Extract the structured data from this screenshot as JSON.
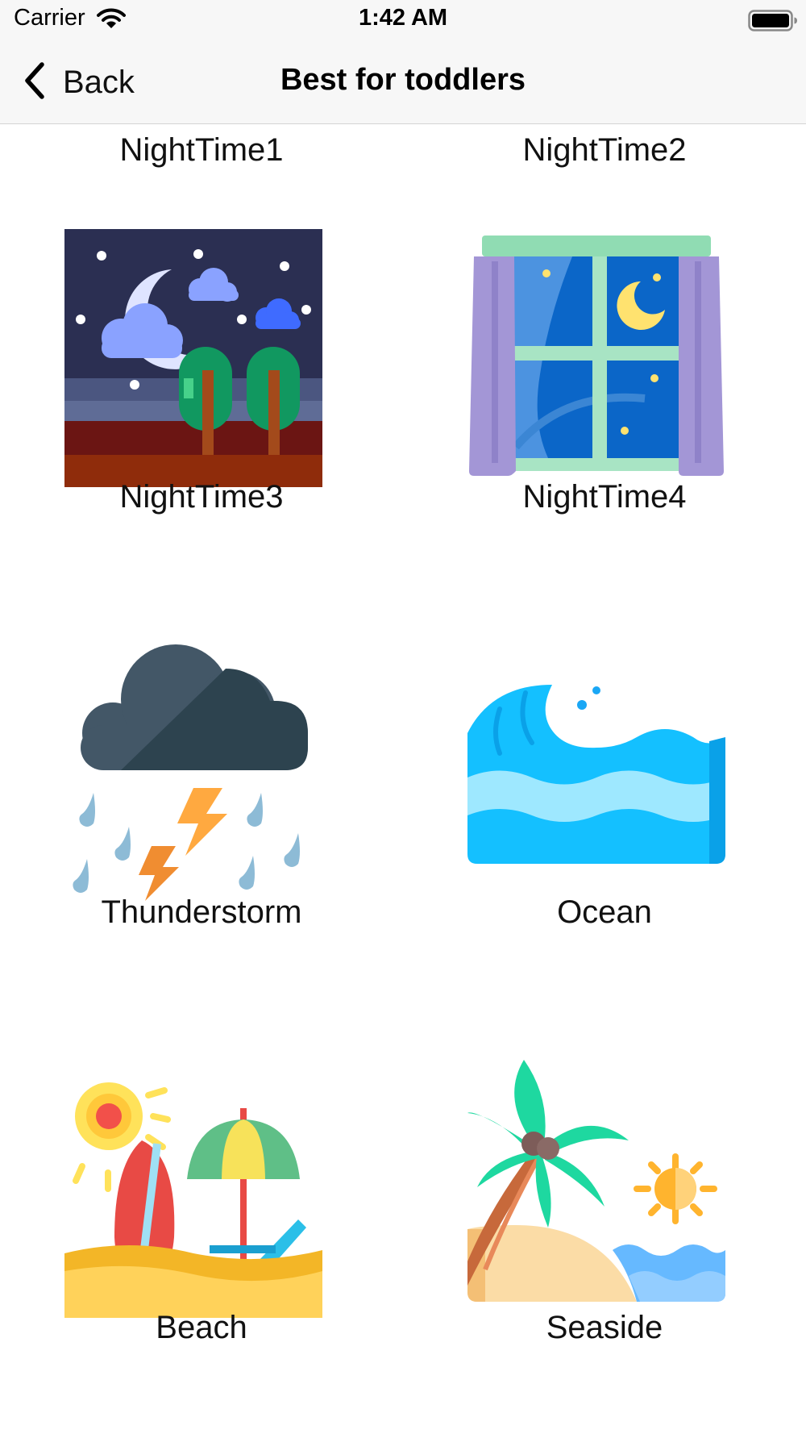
{
  "status": {
    "carrier": "Carrier",
    "time": "1:42 AM"
  },
  "nav": {
    "back_label": "Back",
    "title": "Best for toddlers"
  },
  "sounds": [
    {
      "name": "NightTime1",
      "icon": "night-time-1-icon"
    },
    {
      "name": "NightTime2",
      "icon": "night-time-2-icon"
    },
    {
      "name": "NightTime3",
      "icon": "night-landscape-icon"
    },
    {
      "name": "NightTime4",
      "icon": "night-window-icon"
    },
    {
      "name": "Thunderstorm",
      "icon": "thunderstorm-icon"
    },
    {
      "name": "Ocean",
      "icon": "ocean-wave-icon"
    },
    {
      "name": "Beach",
      "icon": "beach-icon"
    },
    {
      "name": "Seaside",
      "icon": "seaside-icon"
    }
  ],
  "colors": {
    "bar_background": "#f7f7f7",
    "text": "#111111",
    "divider": "#d4d4d4"
  }
}
